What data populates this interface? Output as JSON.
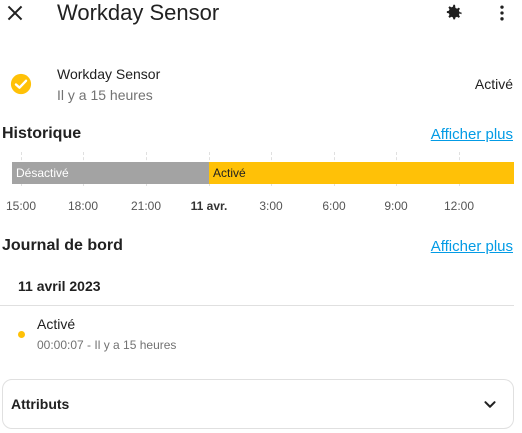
{
  "header": {
    "title": "Workday Sensor",
    "close_icon": "close-icon",
    "settings_icon": "gear-icon",
    "more_icon": "more-vertical-icon"
  },
  "state": {
    "icon": "check-circle-icon",
    "name": "Workday Sensor",
    "time": "Il y a 15 heures",
    "value": "Activé",
    "accent_color": "#ffc107"
  },
  "history": {
    "title": "Historique",
    "more_label": "Afficher plus",
    "off_label": "Désactivé",
    "on_label": "Activé",
    "off_color": "#a3a3a3",
    "on_color": "#ffc107",
    "ticks": [
      "15:00",
      "18:00",
      "21:00",
      "11 avr.",
      "3:00",
      "6:00",
      "9:00",
      "12:00"
    ]
  },
  "logbook": {
    "title": "Journal de bord",
    "more_label": "Afficher plus",
    "date": "11 avril 2023",
    "entries": [
      {
        "state": "Activé",
        "detail": "00:00:07 - Il y a 15 heures"
      }
    ]
  },
  "attributes": {
    "label": "Attributs",
    "chevron_icon": "chevron-down-icon"
  }
}
